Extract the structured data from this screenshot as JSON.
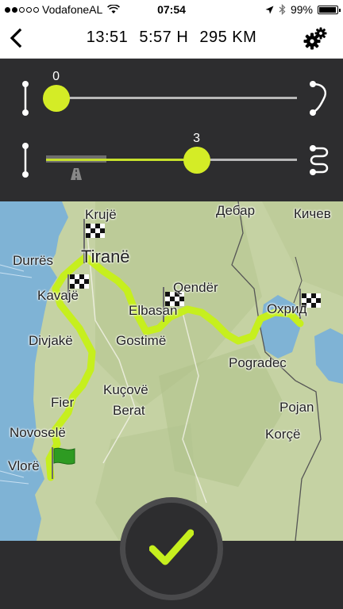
{
  "status_bar": {
    "carrier": "VodafoneAL",
    "time": "07:54",
    "battery": "99%",
    "signal_level": 2,
    "icons": [
      "wifi-icon",
      "location-arrow-icon",
      "bluetooth-icon",
      "battery-icon"
    ]
  },
  "route_summary": {
    "start_time": "13:51",
    "duration": "5:57 H",
    "distance": "295 KM"
  },
  "sliders": {
    "curviness": {
      "value": "0",
      "level_fraction": 0.04,
      "left_icon": "straight-road-icon",
      "right_icon": "curve-icon"
    },
    "hilliness": {
      "value": "3",
      "level_fraction": 0.6,
      "highway_fraction": 0.24,
      "left_icon": "straight-road-icon",
      "right_icon": "winding-road-icon",
      "marker_icon": "highway-icon"
    }
  },
  "map": {
    "labels": [
      "Krujë",
      "Tiranë",
      "Durrës",
      "Kavajë",
      "Qendër",
      "Elbasan",
      "Divjakë",
      "Gostimë",
      "Kuçovë",
      "Berat",
      "Fier",
      "Novoselë",
      "Vlorë",
      "Дебар",
      "Кичев",
      "Охрид",
      "Pogradec",
      "Pojan",
      "Korçë"
    ],
    "route_color": "#c6ef1e",
    "sea_color": "#7fb3d5",
    "land_color": "#c6d3a6"
  },
  "colors": {
    "accent": "#d4ec26",
    "panel": "#2d2d2f"
  }
}
